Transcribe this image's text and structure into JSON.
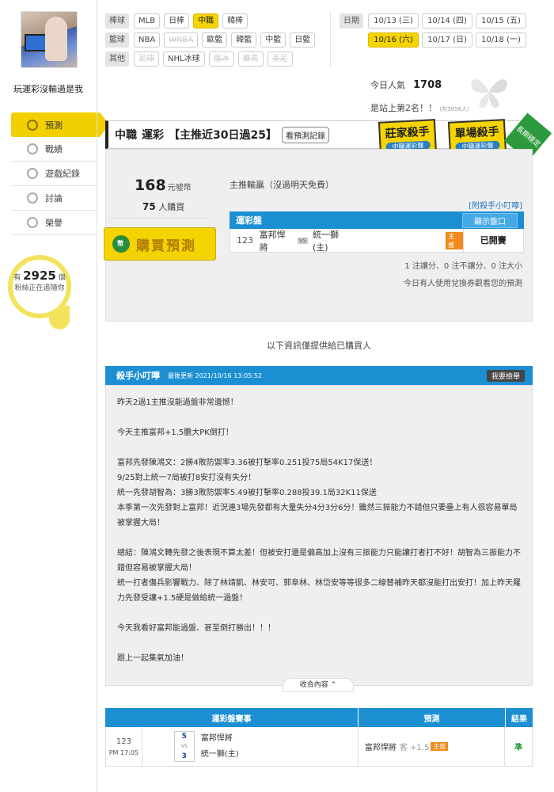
{
  "sidebar": {
    "username": "玩運彩沒輸過是我",
    "nav": [
      "預測",
      "戰績",
      "遊戲紀錄",
      "討論",
      "榮譽"
    ],
    "fans": {
      "prefix": "有",
      "count": "2925",
      "suffix": "個",
      "line2": "粉絲正在追隨你"
    }
  },
  "filters": {
    "baseball": {
      "label": "棒球",
      "items": [
        "MLB",
        "日棒",
        "中職",
        "韓棒"
      ]
    },
    "basketball": {
      "label": "籃球",
      "items": [
        "NBA",
        "WNBA",
        "歐籃",
        "韓籃",
        "中籃",
        "日籃"
      ]
    },
    "other": {
      "label": "其他",
      "items": [
        "足球",
        "NHL冰球",
        "俄冰",
        "賽馬",
        "美足"
      ]
    },
    "date_label": "日期",
    "dates_row1": [
      "10/13 (三)",
      "10/14 (四)",
      "10/15 (五)"
    ],
    "dates_row2": [
      "10/16 (六)",
      "10/17 (日)",
      "10/18 (一)"
    ]
  },
  "stats": {
    "popularity_label": "今日人氣",
    "popularity": "1708",
    "rank_text": "是站上第2名！！",
    "rank_total": "(共3856人)"
  },
  "title": {
    "league": "中職",
    "category": "運彩",
    "streak": "【主推近30日過25】",
    "record_button": "看預測記錄"
  },
  "badges": [
    {
      "title": "莊家殺手",
      "sub": "中職運彩盤"
    },
    {
      "title": "單場殺手",
      "sub": "中職運彩盤"
    }
  ],
  "ribbon": "長期穩定",
  "predict": {
    "price": "168",
    "price_unit": "元噓幣",
    "buyers": "75",
    "buyers_unit": "人購買",
    "buy_button": "購買預測",
    "note": "主推輸贏（沒過明天免費）",
    "helper_link": "[附殺手小叮嚀]",
    "table_title": "運彩盤",
    "show_odds": "顯示盤口",
    "game_no": "123",
    "away": "富邦悍將",
    "vs": "VS",
    "home": "統一獅(主)",
    "main_tag": "主推",
    "status": "已開賽",
    "stat_line": "1 注讓分、0 注不讓分、0 注大小",
    "stat_line2": "今日有人使用兌換券觀看您的預測"
  },
  "info_line": "以下資訊僅提供給已購買人",
  "helper": {
    "title": "殺手小叮嚀",
    "updated": "最後更新 2021/10/16 13:05:52",
    "report": "我要檢舉",
    "paragraphs": [
      "昨天2過1主推沒能過盤非常遺憾！",
      "",
      "今天主推富邦+1.5膽大PK倒打！",
      "",
      "富邦先發陳鴻文：2勝4敗防禦率3.36被打擊率0.251投75局54K17保送！",
      "9/25對上統一7局被打8安打沒有失分！",
      "統一先發胡智為：3勝3敗防禦率5.49被打擊率0.288投39.1局32K11保送",
      "本季第一次先發對上富邦！近況連3場先發都有大量失分4分3分6分！雖然三振能力不錯但只要壘上有人很容易單局被掌握大局！",
      "",
      "總結：陳鴻文轉先發之後表現不算太差！但被安打還是偏高加上沒有三振能力只能讓打者打不好！胡智為三振能力不錯但容易被掌握大局！",
      "統一打者傷兵影響戰力、除了林靖凱、林安可、郭阜林、林岱安等等很多二線替補昨天都沒能打出安打！加上昨天羅力先發受讓+1.5硬是做給統一過盤！",
      "",
      "今天我看好富邦能過盤、甚至倒打勝出！！！",
      "",
      "跟上一起集氣加油！"
    ],
    "collapse": "收合內容 ⌃"
  },
  "results": {
    "headers": [
      "運彩盤賽事",
      "預測",
      "結果"
    ],
    "game_no": "123",
    "time": "PM 17:05",
    "away_score": "5",
    "home_score": "3",
    "vs": "VS",
    "away": "富邦悍將",
    "home": "統一獅(主)",
    "pick": "富邦悍將",
    "pick_type": "客 +1.5",
    "main_tag": "主推",
    "result": "準"
  }
}
